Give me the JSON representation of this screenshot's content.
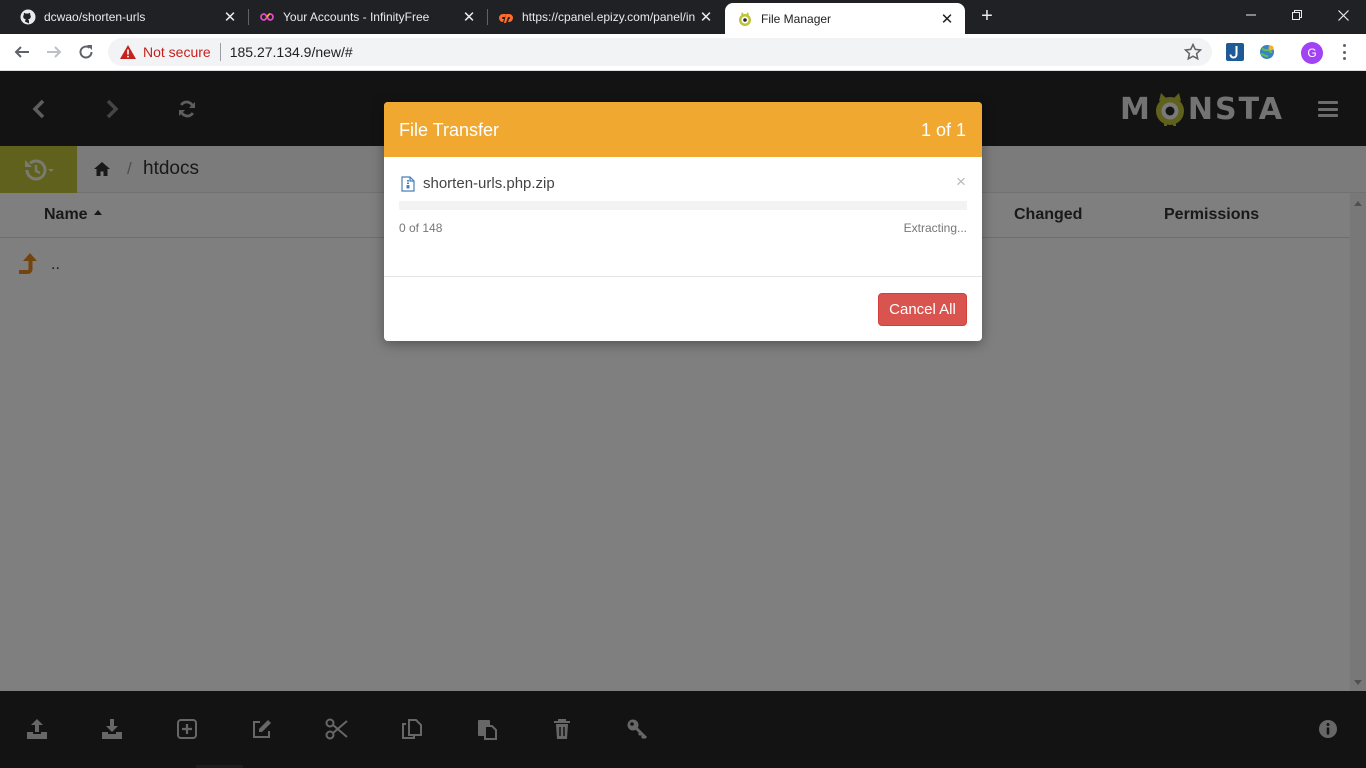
{
  "browser": {
    "tabs": [
      {
        "title": "dcwao/shorten-urls",
        "icon": "github-icon"
      },
      {
        "title": "Your Accounts - InfinityFree",
        "icon": "infinityfree-icon"
      },
      {
        "title": "https://cpanel.epizy.com/panel/in",
        "icon": "cpanel-icon"
      },
      {
        "title": "File Manager",
        "icon": "monsta-icon",
        "active": true
      }
    ],
    "address": {
      "security_label": "Not secure",
      "url": "185.27.134.9/new/#"
    },
    "profile_initial": "G"
  },
  "app": {
    "logo_text": {
      "left": "M",
      "right": "NSTA"
    },
    "breadcrumb": {
      "separator": "/",
      "current": "htdocs"
    },
    "columns": {
      "name": "Name",
      "changed": "Changed",
      "permissions": "Permissions"
    },
    "rows": [
      {
        "name": ".."
      }
    ]
  },
  "modal": {
    "title": "File Transfer",
    "counter": "1 of 1",
    "item": {
      "filename": "shorten-urls.php.zip",
      "progress_text": "0 of 148",
      "progress_fraction": 0,
      "status": "Extracting..."
    },
    "cancel_label": "Cancel All"
  },
  "colors": {
    "modal_header": "#f0a830",
    "cancel_button": "#d9534f",
    "history_button": "#bfc33a",
    "app_header": "#272727"
  }
}
